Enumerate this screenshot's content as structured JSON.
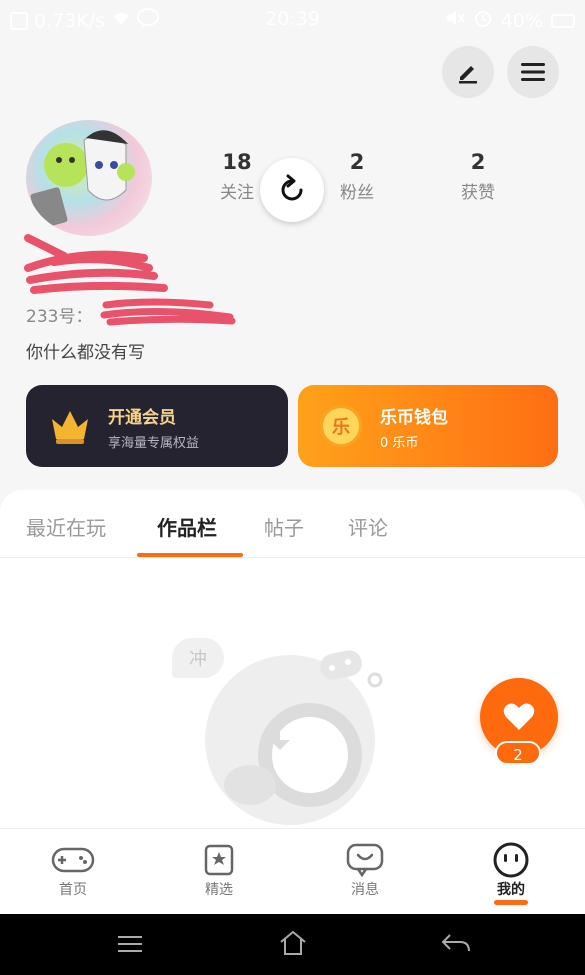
{
  "status_bar": {
    "speed": "0.73K/s",
    "time": "20:39",
    "battery": "40%"
  },
  "profile": {
    "stats": [
      {
        "value": "18",
        "label": "关注"
      },
      {
        "value": "2",
        "label": "粉丝"
      },
      {
        "value": "2",
        "label": "获赞"
      }
    ],
    "id_prefix": "233号：",
    "bio": "你什么都没有写"
  },
  "cards": {
    "vip": {
      "title": "开通会员",
      "subtitle": "享海量专属权益"
    },
    "wallet": {
      "icon_text": "乐",
      "title": "乐币钱包",
      "subtitle": "0 乐币"
    }
  },
  "tabs": [
    "最近在玩",
    "作品栏",
    "帖子",
    "评论"
  ],
  "empty_bubble": "冲",
  "fab": {
    "badge": "2"
  },
  "bottom_nav": [
    "首页",
    "精选",
    "消息",
    "我的"
  ],
  "colors": {
    "accent": "#ff6a0f",
    "vip_bg": "#25232f",
    "vip_text": "#f6d38a"
  }
}
